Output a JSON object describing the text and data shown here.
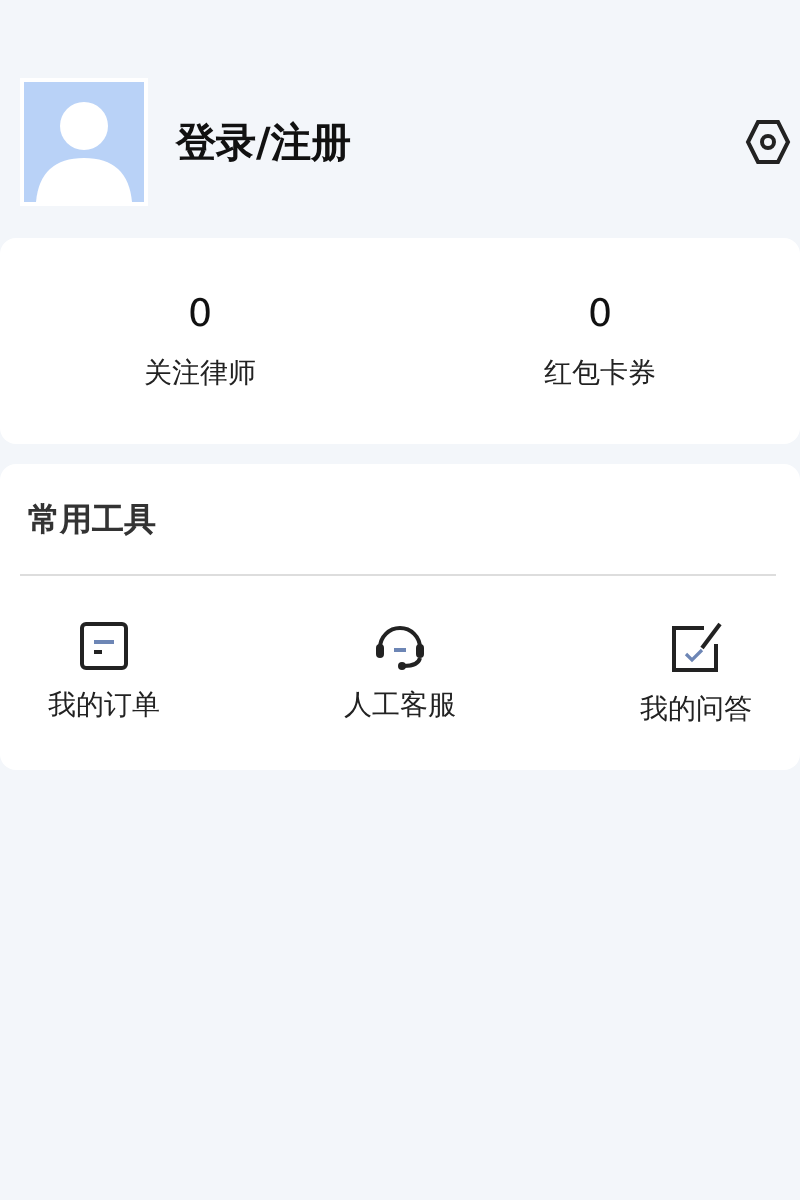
{
  "profile": {
    "login_label": "登录/注册"
  },
  "stats": [
    {
      "value": "0",
      "label": "关注律师"
    },
    {
      "value": "0",
      "label": "红包卡券"
    }
  ],
  "tools": {
    "title": "常用工具",
    "items": [
      {
        "kind": "order",
        "label": "我的订单"
      },
      {
        "kind": "service",
        "label": "人工客服"
      },
      {
        "kind": "answer",
        "label": "我的问答"
      }
    ]
  }
}
